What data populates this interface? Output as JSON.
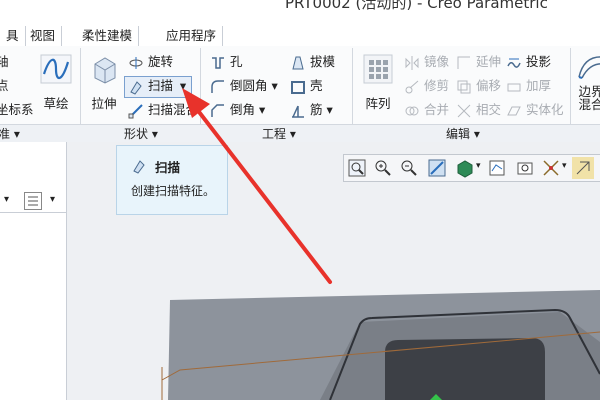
{
  "window": {
    "title": "PRT0002 (活动的) - Creo Parametric"
  },
  "menu": {
    "tabs": [
      "具",
      "视图",
      "柔性建模",
      "应用程序"
    ]
  },
  "ribbon": {
    "datum": {
      "items": [
        "轴",
        "点",
        "坐标系"
      ],
      "sketch_label": "草绘"
    },
    "shapes": {
      "extrude_label": "拉伸",
      "revolve_label": "旋转",
      "sweep_label": "扫描",
      "swept_blend_label": "扫描混合"
    },
    "engineering": {
      "hole_label": "孔",
      "round_label": "倒圆角",
      "chamfer_label": "倒角",
      "draft_label": "拔模",
      "shell_label": "壳",
      "rib_label": "筋"
    },
    "editing": {
      "pattern_label": "阵列",
      "mirror_label": "镜像",
      "extend_label": "延伸",
      "project_label": "投影",
      "trim_label": "修剪",
      "offset_label": "偏移",
      "thicken_label": "加厚",
      "merge_label": "合并",
      "intersect_label": "相交",
      "solidify_label": "实体化"
    },
    "surfaces": {
      "boundary_label": "边界",
      "blend_label": "混合"
    },
    "groups": {
      "datum": "准 ▾",
      "shapes": "形状 ▾",
      "engineering": "工程 ▾",
      "editing": "编辑 ▾"
    }
  },
  "tooltip": {
    "title": "扫描",
    "description": "创建扫描特征。"
  },
  "colors": {
    "accent": "#2a6ebb",
    "arrow": "#e8322b",
    "model": "#8d939c"
  }
}
